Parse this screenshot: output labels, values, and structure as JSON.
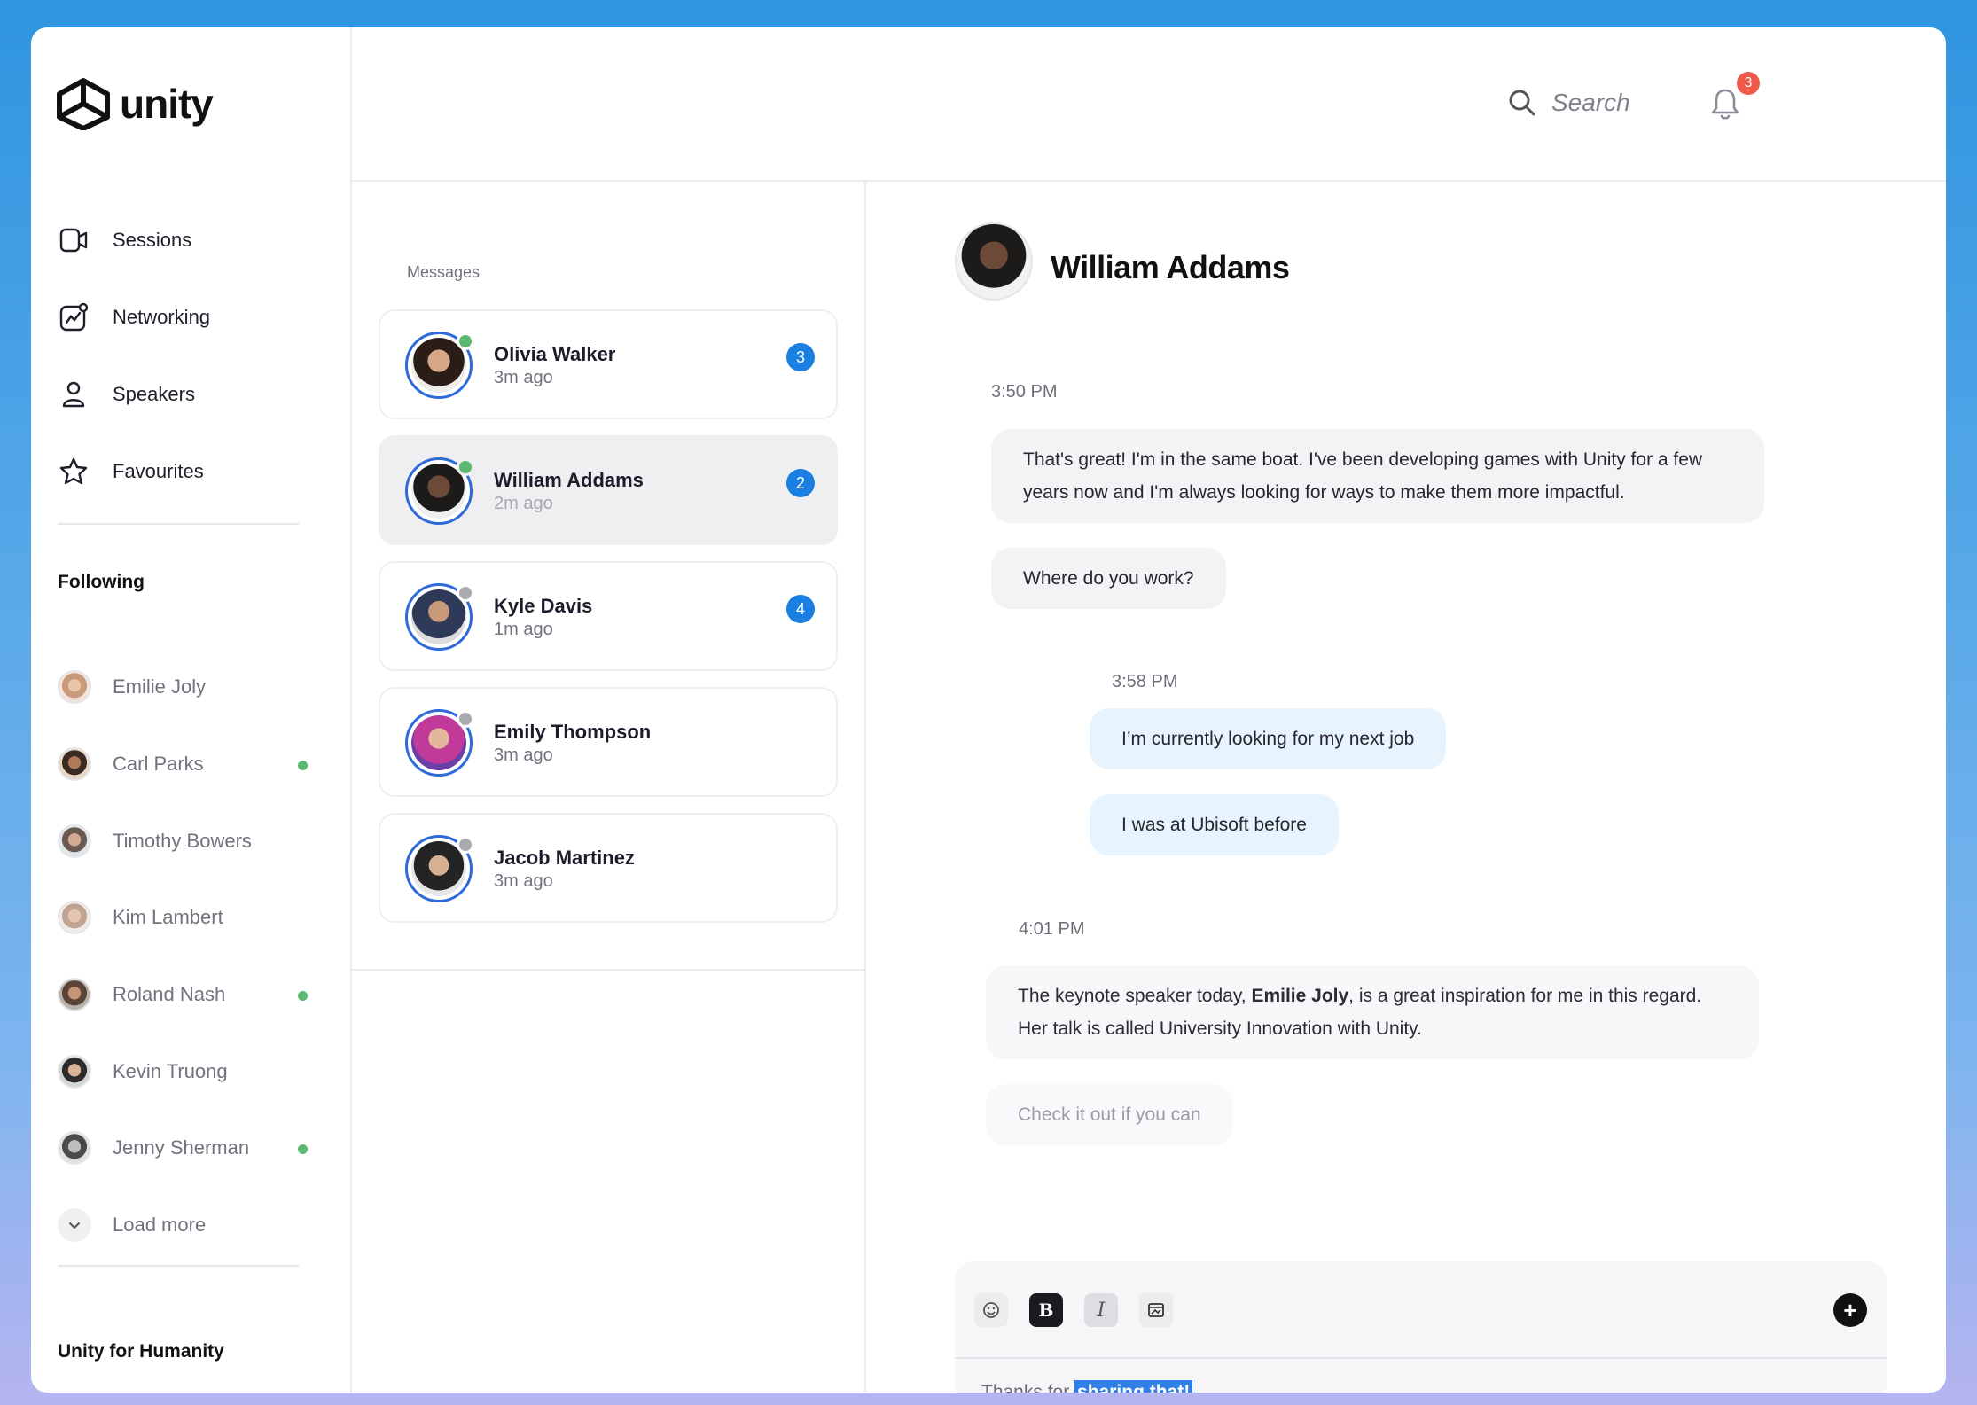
{
  "brand": {
    "name": "unity"
  },
  "nav": [
    {
      "label": "Sessions",
      "icon": "video-icon"
    },
    {
      "label": "Networking",
      "icon": "chart-icon"
    },
    {
      "label": "Speakers",
      "icon": "user-icon"
    },
    {
      "label": "Favourites",
      "icon": "star-icon"
    }
  ],
  "following": {
    "title": "Following",
    "people": [
      {
        "name": "Emilie Joly",
        "online": false
      },
      {
        "name": "Carl Parks",
        "online": true
      },
      {
        "name": "Timothy Bowers",
        "online": false
      },
      {
        "name": "Kim Lambert",
        "online": false
      },
      {
        "name": "Roland Nash",
        "online": true
      },
      {
        "name": "Kevin Truong",
        "online": false
      },
      {
        "name": "Jenny Sherman",
        "online": true
      }
    ],
    "load_more": "Load more"
  },
  "section2": {
    "title": "Unity for Humanity"
  },
  "header": {
    "search_placeholder": "Search",
    "notification_count": "3"
  },
  "messages": {
    "label": "Messages",
    "conversations": [
      {
        "name": "Olivia Walker",
        "time": "3m ago",
        "unread": "3",
        "online": true
      },
      {
        "name": "William Addams",
        "time": "2m ago",
        "unread": "2",
        "online": true
      },
      {
        "name": "Kyle Davis",
        "time": "1m ago",
        "unread": "4",
        "online": false
      },
      {
        "name": "Emily Thompson",
        "time": "3m ago",
        "unread": "",
        "online": false
      },
      {
        "name": "Jacob Martinez",
        "time": "3m ago",
        "unread": "",
        "online": false
      }
    ]
  },
  "chat": {
    "contact_name": "William Addams",
    "ts1": "3:50 PM",
    "msg1": "That's great! I'm in the same boat. I've been developing games with Unity for a few years now and I'm always looking for ways to make them more impactful.",
    "msg2": "Where do you work?",
    "ts2": "3:58 PM",
    "msg3": "I’m currently looking for my next job",
    "msg4": "I was at Ubisoft before",
    "ts3": "4:01 PM",
    "msg5_pre": "The keynote speaker today, ",
    "msg5_bold": "Emilie Joly",
    "msg5_post": ", is a great inspiration for me in this regard. Her talk is called University Innovation with Unity.",
    "msg6": "Check it out if you can",
    "composer_text": "Thanks for ",
    "composer_selected": "sharing that!",
    "bold_label": "B",
    "italic_label": "I",
    "send_label": "+"
  },
  "colors": {
    "accent": "#1a7fe0",
    "online": "#5bb870",
    "offline": "#a9a9b0",
    "badge_red": "#f05a4a",
    "outgoing_bubble": "#e7f4fd"
  }
}
